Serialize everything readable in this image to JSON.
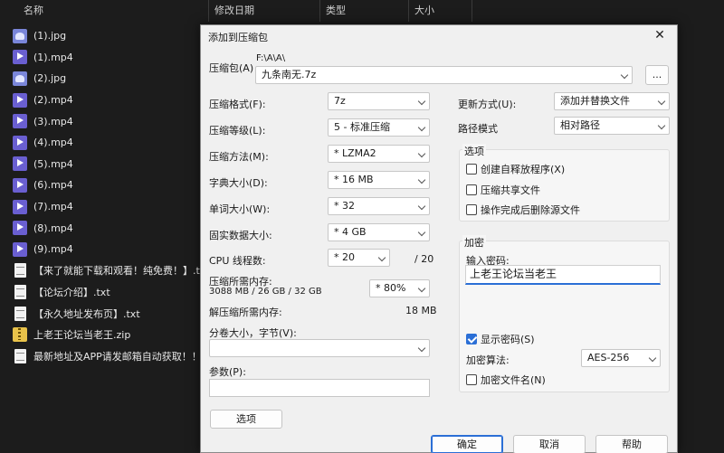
{
  "explorer": {
    "columns": {
      "name": "名称",
      "modified": "修改日期",
      "type": "类型",
      "size": "大小"
    },
    "files": [
      {
        "name": "(1).jpg",
        "icon": "jpg"
      },
      {
        "name": "(1).mp4",
        "icon": "mp4"
      },
      {
        "name": "(2).jpg",
        "icon": "jpg"
      },
      {
        "name": "(2).mp4",
        "icon": "mp4"
      },
      {
        "name": "(3).mp4",
        "icon": "mp4"
      },
      {
        "name": "(4).mp4",
        "icon": "mp4"
      },
      {
        "name": "(5).mp4",
        "icon": "mp4"
      },
      {
        "name": "(6).mp4",
        "icon": "mp4"
      },
      {
        "name": "(7).mp4",
        "icon": "mp4"
      },
      {
        "name": "(8).mp4",
        "icon": "mp4"
      },
      {
        "name": "(9).mp4",
        "icon": "mp4"
      },
      {
        "name": "【来了就能下载和观看！纯免费！】.txt",
        "icon": "txt"
      },
      {
        "name": "【论坛介绍】.txt",
        "icon": "txt"
      },
      {
        "name": "【永久地址发布页】.txt",
        "icon": "txt"
      },
      {
        "name": "上老王论坛当老王.zip",
        "icon": "zip"
      },
      {
        "name": "最新地址及APP请发邮箱自动获取！！！...",
        "icon": "txt"
      }
    ]
  },
  "dialog": {
    "title": "添加到压缩包",
    "archive_label": "压缩包(A)",
    "archive_path": "F:\\A\\A\\",
    "archive_name": "九条南无.7z",
    "browse_label": "...",
    "format_label": "压缩格式(F):",
    "format_value": "7z",
    "level_label": "压缩等级(L):",
    "level_value": "5 - 标准压缩",
    "method_label": "压缩方法(M):",
    "method_value": "* LZMA2",
    "dict_label": "字典大小(D):",
    "dict_value": "* 16 MB",
    "word_label": "单词大小(W):",
    "word_value": "* 32",
    "solid_label": "固实数据大小:",
    "solid_value": "* 4 GB",
    "threads_label": "CPU 线程数:",
    "threads_value": "* 20",
    "threads_total": "/ 20",
    "mem_label": "压缩所需内存:",
    "mem_detail": "3088 MB / 26 GB / 32 GB",
    "mem_percent": "* 80%",
    "decomp_label": "解压缩所需内存:",
    "decomp_value": "18 MB",
    "split_label": "分卷大小，字节(V):",
    "split_value": "",
    "params_label": "参数(P):",
    "params_value": "",
    "options_button": "选项",
    "update_label": "更新方式(U):",
    "update_value": "添加并替换文件",
    "pathmode_label": "路径模式",
    "pathmode_value": "相对路径",
    "options_group": {
      "title": "选项",
      "sfx": "创建自释放程序(X)",
      "shared": "压缩共享文件",
      "delete": "操作完成后删除源文件"
    },
    "encrypt_group": {
      "title": "加密",
      "pwd_label": "输入密码:",
      "pwd_value": "上老王论坛当老王",
      "show_pwd": "显示密码(S)",
      "algo_label": "加密算法:",
      "algo_value": "AES-256",
      "encrypt_names": "加密文件名(N)"
    },
    "ok": "确定",
    "cancel": "取消",
    "help": "帮助",
    "close_glyph": "✕"
  }
}
